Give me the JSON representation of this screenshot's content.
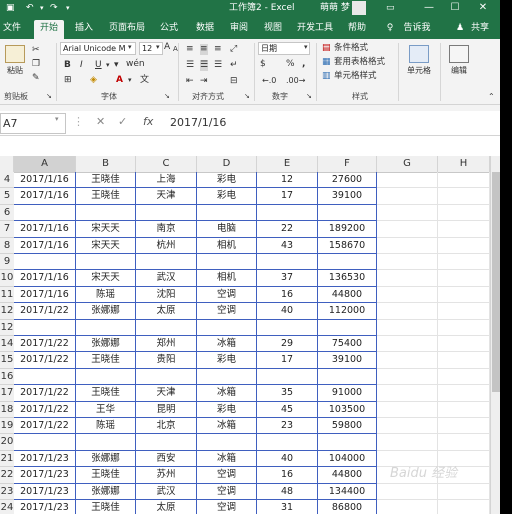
{
  "titlebar": {
    "title": "工作簿2 - Excel",
    "user": "萌萌 梦",
    "save_icon": "save-icon",
    "undo_icon": "undo-icon",
    "redo_icon": "redo-icon",
    "minimize": "—",
    "restore": "☐",
    "close": "✕"
  },
  "tabs": {
    "file": "文件",
    "home": "开始",
    "insert": "插入",
    "layout": "页面布局",
    "formulas": "公式",
    "data": "数据",
    "review": "审阅",
    "view": "视图",
    "developer": "开发工具",
    "help": "帮助",
    "search_icon": "lightbulb-icon",
    "tell": "告诉我",
    "share": "共享"
  },
  "ribbon": {
    "paste": "粘贴",
    "clipboard": "剪贴板",
    "font_name": "Arial Unicode M",
    "font_size": "12",
    "bold": "B",
    "italic": "I",
    "underline": "U",
    "grow": "A",
    "shrink": "A",
    "wen": "wén",
    "font_group": "字体",
    "align_group": "对齐方式",
    "number_format": "日期",
    "percent": "%",
    "comma": ",",
    "currency": "$",
    "number_group": "数字",
    "cond_format": "条件格式",
    "table_format": "套用表格格式",
    "cell_style": "单元格样式",
    "styles_group": "样式",
    "cells": "单元格",
    "editing": "编辑"
  },
  "formula_bar": {
    "name_box": "A7",
    "cancel": "✕",
    "enter": "✓",
    "fx": "fx",
    "content": "2017/1/16"
  },
  "grid": {
    "columns": [
      "A",
      "B",
      "C",
      "D",
      "E",
      "F",
      "G",
      "H"
    ],
    "rows": [
      {
        "num": "4",
        "cells": [
          "2017/1/16",
          "王晓佳",
          "上海",
          "彩电",
          "12",
          "27600"
        ]
      },
      {
        "num": "5",
        "cells": [
          "2017/1/16",
          "王晓佳",
          "天津",
          "彩电",
          "17",
          "39100"
        ]
      },
      {
        "num": "6",
        "cells": [
          "",
          "",
          "",
          "",
          "",
          ""
        ]
      },
      {
        "num": "7",
        "cells": [
          "2017/1/16",
          "宋天天",
          "南京",
          "电脑",
          "22",
          "189200"
        ]
      },
      {
        "num": "8",
        "cells": [
          "2017/1/16",
          "宋天天",
          "杭州",
          "相机",
          "43",
          "158670"
        ]
      },
      {
        "num": "9",
        "cells": [
          "",
          "",
          "",
          "",
          "",
          ""
        ]
      },
      {
        "num": "10",
        "cells": [
          "2017/1/16",
          "宋天天",
          "武汉",
          "相机",
          "37",
          "136530"
        ]
      },
      {
        "num": "11",
        "cells": [
          "2017/1/16",
          "陈瑶",
          "沈阳",
          "空调",
          "16",
          "44800"
        ]
      },
      {
        "num": "12",
        "cells": [
          "2017/1/22",
          "张娜娜",
          "太原",
          "空调",
          "40",
          "112000"
        ]
      },
      {
        "num": "12",
        "cells": [
          "",
          "",
          "",
          "",
          "",
          ""
        ]
      },
      {
        "num": "14",
        "cells": [
          "2017/1/22",
          "张娜娜",
          "郑州",
          "冰箱",
          "29",
          "75400"
        ]
      },
      {
        "num": "15",
        "cells": [
          "2017/1/22",
          "王晓佳",
          "贵阳",
          "彩电",
          "17",
          "39100"
        ]
      },
      {
        "num": "16",
        "cells": [
          "",
          "",
          "",
          "",
          "",
          ""
        ]
      },
      {
        "num": "17",
        "cells": [
          "2017/1/22",
          "王晓佳",
          "天津",
          "冰箱",
          "35",
          "91000"
        ]
      },
      {
        "num": "18",
        "cells": [
          "2017/1/22",
          "王华",
          "昆明",
          "彩电",
          "45",
          "103500"
        ]
      },
      {
        "num": "19",
        "cells": [
          "2017/1/22",
          "陈瑶",
          "北京",
          "冰箱",
          "23",
          "59800"
        ]
      },
      {
        "num": "20",
        "cells": [
          "",
          "",
          "",
          "",
          "",
          ""
        ]
      },
      {
        "num": "21",
        "cells": [
          "2017/1/23",
          "张娜娜",
          "西安",
          "冰箱",
          "40",
          "104000"
        ]
      },
      {
        "num": "22",
        "cells": [
          "2017/1/23",
          "王晓佳",
          "苏州",
          "空调",
          "16",
          "44800"
        ]
      },
      {
        "num": "23",
        "cells": [
          "2017/1/23",
          "张娜娜",
          "武汉",
          "空调",
          "48",
          "134400"
        ]
      },
      {
        "num": "24",
        "cells": [
          "2017/1/23",
          "王晓佳",
          "太原",
          "空调",
          "31",
          "86800"
        ]
      }
    ]
  },
  "watermark": "Baidu 经验",
  "colors": {
    "excel_green": "#217346",
    "border_blue": "#3f5fbf"
  }
}
